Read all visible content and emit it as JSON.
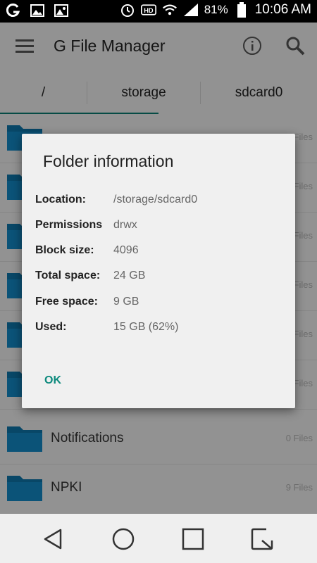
{
  "status_bar": {
    "battery": "81%",
    "time": "10:06 AM",
    "icons": [
      "g-icon",
      "image-icon",
      "gallery-icon",
      "alarm-icon",
      "hd-icon",
      "wifi-icon",
      "signal-icon",
      "battery-icon"
    ]
  },
  "app_bar": {
    "title": "G File Manager"
  },
  "path_tabs": [
    "/",
    "storage",
    "sdcard0"
  ],
  "files": [
    {
      "name": "",
      "count": "Files"
    },
    {
      "name": "",
      "count": "Files"
    },
    {
      "name": "",
      "count": "Files"
    },
    {
      "name": "",
      "count": "Files"
    },
    {
      "name": "",
      "count": "Files"
    },
    {
      "name": "",
      "count": "Files"
    },
    {
      "name": "Notifications",
      "count": "0 Files"
    },
    {
      "name": "NPKI",
      "count": "9 Files"
    }
  ],
  "dialog": {
    "title": "Folder information",
    "rows": [
      {
        "label": "Location:",
        "value": "/storage/sdcard0"
      },
      {
        "label": "Permissions",
        "value": "drwx"
      },
      {
        "label": "Block size:",
        "value": "4096"
      },
      {
        "label": "Total space:",
        "value": "24 GB"
      },
      {
        "label": "Free space:",
        "value": "9 GB"
      },
      {
        "label": "Used:",
        "value": "15 GB (62%)"
      }
    ],
    "ok_label": "OK"
  },
  "colors": {
    "accent": "#0a7a70",
    "folder": "#0d73a6"
  }
}
